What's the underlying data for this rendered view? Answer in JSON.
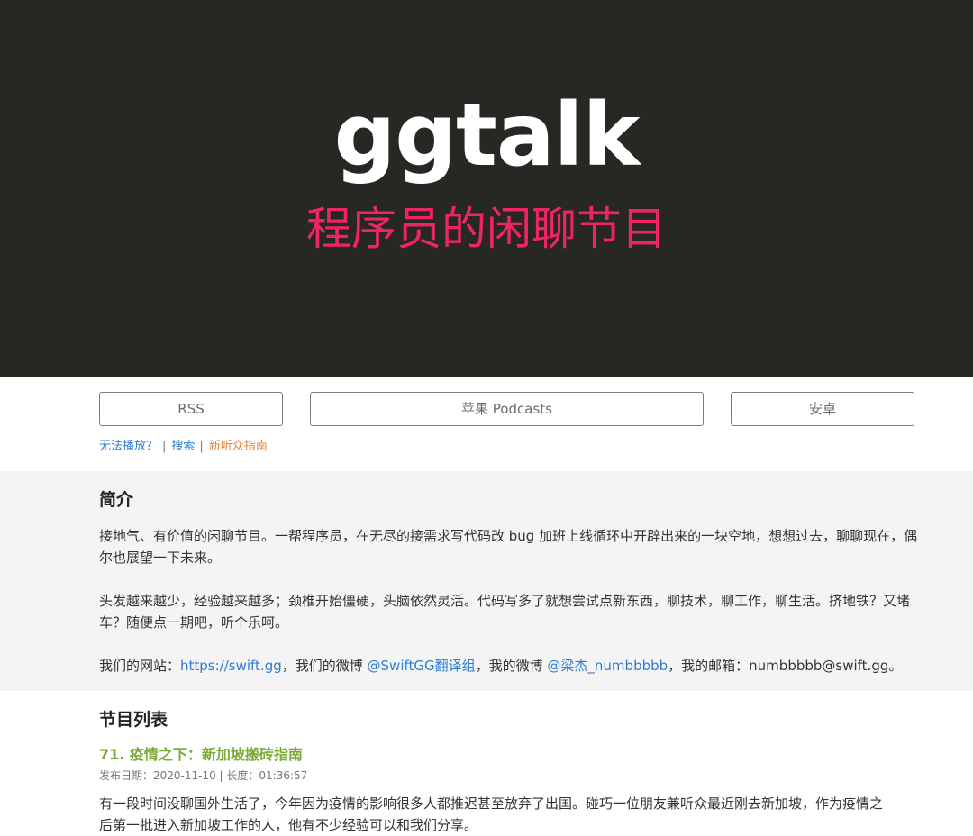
{
  "colors": {
    "hero_bg": "#272723",
    "subtitle": "#EE2467",
    "link": "#2E7DD1",
    "guide_link": "#E8803A",
    "episode_title": "#7BAA37",
    "intro_bg": "#F4F4F4"
  },
  "hero": {
    "title": "ggtalk",
    "subtitle": "程序员的闲聊节目"
  },
  "subscribe": {
    "rss": "RSS",
    "apple": "苹果 Podcasts",
    "android": "安卓"
  },
  "helper_links": {
    "cant_play": "无法播放？",
    "separator": "|",
    "search": "搜索",
    "new_listener_guide": "新听众指南"
  },
  "intro": {
    "heading": "简介",
    "para1": "接地气、有价值的闲聊节目。一帮程序员，在无尽的接需求写代码改 bug 加班上线循环中开辟出来的一块空地，想想过去，聊聊现在，偶尔也展望一下未来。",
    "para2": "头发越来越少，经验越来越多；颈椎开始僵硬，头脑依然灵活。代码写多了就想尝试点新东西，聊技术，聊工作，聊生活。挤地铁？又堵车？随便点一期吧，听个乐呵。",
    "contact": {
      "website_prefix": "我们的网站：",
      "website": "https://swift.gg",
      "weibo_prefix": "，我们的微博 ",
      "weibo": "@SwiftGG翻译组",
      "my_weibo_prefix": "，我的微博 ",
      "my_weibo": "@梁杰_numbbbbb",
      "email_prefix": "，我的邮箱：",
      "email": "numbbbbb@swift.gg",
      "end": "。"
    }
  },
  "episodes": {
    "heading": "节目列表",
    "items": [
      {
        "title": "71. 疫情之下：新加坡搬砖指南",
        "meta": "发布日期：2020-11-10 | 长度：01:36:57",
        "summary": "有一段时间没聊国外生活了，今年因为疫情的影响很多人都推迟甚至放弃了出国。碰巧一位朋友兼听众最近刚去新加坡，作为疫情之后第一批进入新加坡工作的人，他有不少经验可以和我们分享。"
      }
    ]
  }
}
